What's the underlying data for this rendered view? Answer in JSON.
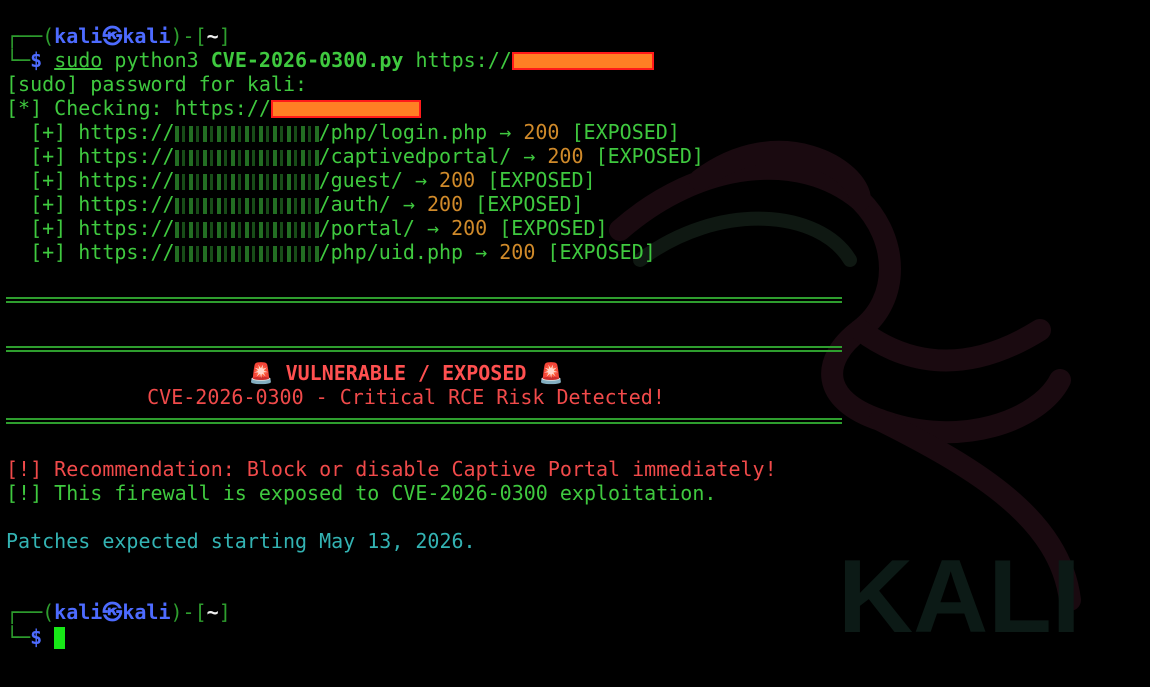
{
  "colors": {
    "background": "#000000",
    "text_green": "#3fc93f",
    "prompt_blue": "#4d6bff",
    "status_orange": "#d08a2a",
    "alert_red": "#f04a4a",
    "notice_cyan": "#33b3b3",
    "redaction_fill": "#ff7f24",
    "redaction_border": "#ff1a1a"
  },
  "prompt": {
    "frame_top": "┌──(",
    "user": "kali",
    "at_symbol": "㉿",
    "host": "kali",
    "frame_mid": ")-[",
    "path": "~",
    "frame_end": "]",
    "frame_bottom": "└─",
    "dollar": "$"
  },
  "command": {
    "sudo": "sudo",
    "interpreter": "python3",
    "script": "CVE-2026-0300.py",
    "url_prefix": "https://"
  },
  "sudo_prompt": "[sudo] password for kali:",
  "checking": {
    "prefix": "[*] Checking: https://"
  },
  "results": [
    {
      "marker": "[+]",
      "url_prefix": "https://",
      "path": "/php/login.php",
      "arrow": "→",
      "code": "200",
      "status": "[EXPOSED]"
    },
    {
      "marker": "[+]",
      "url_prefix": "https://",
      "path": "/captivedportal/",
      "arrow": "→",
      "code": "200",
      "status": "[EXPOSED]"
    },
    {
      "marker": "[+]",
      "url_prefix": "https://",
      "path": "/guest/",
      "arrow": "→",
      "code": "200",
      "status": "[EXPOSED]"
    },
    {
      "marker": "[+]",
      "url_prefix": "https://",
      "path": "/auth/",
      "arrow": "→",
      "code": "200",
      "status": "[EXPOSED]"
    },
    {
      "marker": "[+]",
      "url_prefix": "https://",
      "path": "/portal/",
      "arrow": "→",
      "code": "200",
      "status": "[EXPOSED]"
    },
    {
      "marker": "[+]",
      "url_prefix": "https://",
      "path": "/php/uid.php",
      "arrow": "→",
      "code": "200",
      "status": "[EXPOSED]"
    }
  ],
  "banner": {
    "siren_icon": "🚨",
    "title": "VULNERABLE / EXPOSED",
    "subtitle": "CVE-2026-0300 - Critical RCE Risk Detected!"
  },
  "recommendations": [
    "[!] Recommendation: Block or disable Captive Portal immediately!",
    "[!] This firewall is exposed to CVE-2026-0300 exploitation."
  ],
  "patch_notice": "Patches expected starting May 13, 2026.",
  "wallpaper": {
    "logo_text": "KALI",
    "icon": "kali-dragon-icon"
  }
}
